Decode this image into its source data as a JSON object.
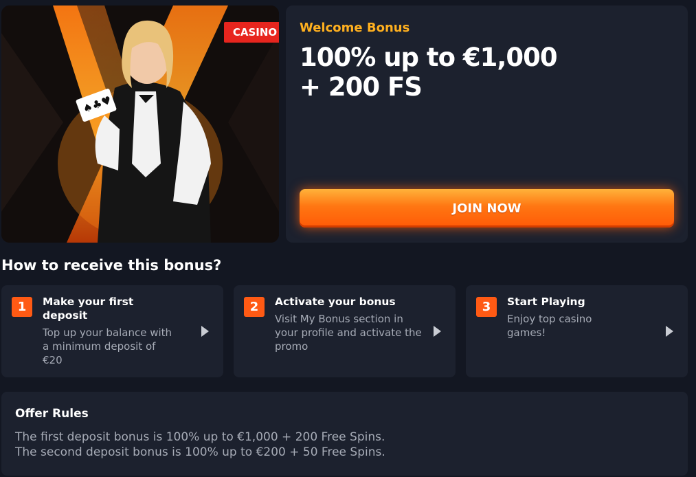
{
  "hero": {
    "badge": "CASINO",
    "image_description_icon": "croupier-image"
  },
  "bonus": {
    "label": "Welcome Bonus",
    "title_line1": "100% up to €1,000",
    "title_line2": "+ 200 FS",
    "cta": "JOIN NOW"
  },
  "how_to": {
    "title": "How to receive this bonus?",
    "steps": [
      {
        "number": "1",
        "title": "Make your first deposit",
        "description": "Top up your balance with a minimum deposit of €20",
        "icon": "arrow-right-icon"
      },
      {
        "number": "2",
        "title": "Activate your bonus",
        "description": "Visit My Bonus section in your profile and activate the promo",
        "icon": "arrow-right-icon"
      },
      {
        "number": "3",
        "title": "Start Playing",
        "description": "Enjoy top casino games!",
        "icon": "arrow-right-icon"
      }
    ]
  },
  "rules": {
    "title": "Offer Rules",
    "lines": [
      "The first deposit bonus is 100% up to €1,000 + 200 Free Spins.",
      "The second deposit bonus is 100% up to €200 + 50 Free Spins."
    ]
  },
  "colors": {
    "background": "#131722",
    "card": "#1c212e",
    "accent_orange": "#ff5a14",
    "label_yellow": "#ffb01f",
    "badge_red": "#e7251e",
    "muted_text": "#a6abb6"
  }
}
